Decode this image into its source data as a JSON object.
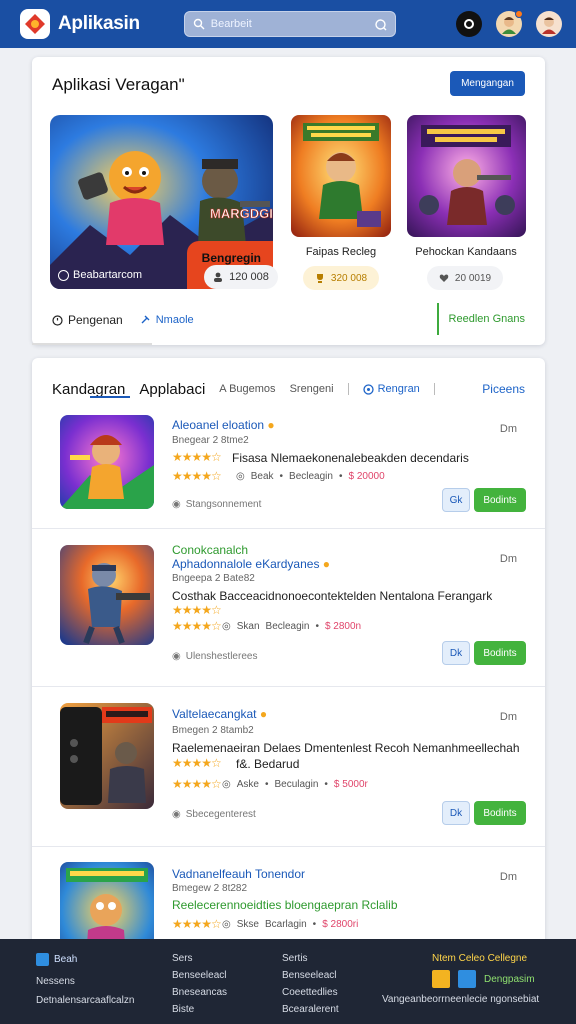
{
  "header": {
    "app_title": "Aplikasin",
    "search_placeholder": "Bearbeit"
  },
  "featured": {
    "title": "Aplikasi Veragan\"",
    "action_button": "Mengangan",
    "big_tile": {
      "badge_text": "Bengregin",
      "banner_text": "MARGDGINI",
      "site_text": "Beabartarcom",
      "stat": "120 008"
    },
    "tile2": {
      "caption": "Faipas Recleg",
      "stat": "320 008"
    },
    "tile3": {
      "caption": "Pehockan Kandaans",
      "stat": "20 0019"
    },
    "footer_left": "Pengenan",
    "footer_link": "Nmaole",
    "footer_right": "Reedlen Gnans"
  },
  "tabs": {
    "main": "Kandagran",
    "active": "Applabaci",
    "tab3": "A Bugemos",
    "tab4": "Srengeni",
    "tab5": "Rengran",
    "right": "Piceens"
  },
  "rows": [
    {
      "title": "Aleoanel eloation",
      "subtitle": "Bnegear 2 8tme2",
      "desc": "Fisasa Nlemaekonenalebeakden decendaris",
      "meta1": "Beak",
      "meta2": "Becleagin",
      "price": "$ 20000",
      "dev": "Stangsonnement",
      "more": "Dm",
      "btn_small": "Gk",
      "btn_go": "Bodints",
      "stars": "★★★★☆"
    },
    {
      "title": "Conokcanalch",
      "title2": "Aphadonnalole eKardyanes",
      "subtitle": "Bngeepa 2 Bate82",
      "desc": "Costhak Bacceacidnonoecontektelden Nentalona Ferangark",
      "meta1": "Skan",
      "meta2": "Becleagin",
      "price": "$ 2800n",
      "dev": "Ulenshestlerees",
      "more": "Dm",
      "btn_small": "Dk",
      "btn_go": "Bodints",
      "stars": "★★★★☆"
    },
    {
      "title": "Valtelaecangkat",
      "subtitle": "Bmegen 2 8tamb2",
      "desc": "Raelemenaeiran Delaes Dmentenlest Recoh Nemanhmeellechah",
      "desc2": "f&. Bedarud",
      "meta1": "Aske",
      "meta2": "Beculagin",
      "price": "$ 5000r",
      "dev": "Sbecegenterest",
      "more": "Dm",
      "btn_small": "Dk",
      "btn_go": "Bodints",
      "stars": "★★★★☆"
    },
    {
      "title": "Vadnanelfeauh Tonendor",
      "subtitle": "Bmegew 2 8t282",
      "desc": "Reelecerennoeidties bloengaepran Rclalib",
      "meta1": "Skse",
      "meta2": "Bcarlagin",
      "price": "$ 2800ri",
      "more": "Dm",
      "stars": "★★★★☆"
    }
  ],
  "footer": {
    "col1": [
      "Beah",
      "Nessens",
      "Detnalensarcaaflcalzn"
    ],
    "col2": [
      "Sers",
      "Benseeleacl",
      "Bneseancas",
      "Biste"
    ],
    "col3": [
      "Sertis",
      "Benseeleacl",
      "Coeettedlies",
      "Bcearalerent"
    ],
    "col4_title": "Ntem Celeo Cellegne",
    "col4_brand": "Dengpasim",
    "col4_bottom": "Vangeanbeorrneenlecie ngonsebiat"
  },
  "colors": {
    "topbar": "#1a4fa3",
    "accent_blue": "#1b59b8",
    "accent_green": "#43b33d",
    "price_red": "#e0456a",
    "star": "#f4a71d",
    "footer_bg": "#1f2635"
  }
}
